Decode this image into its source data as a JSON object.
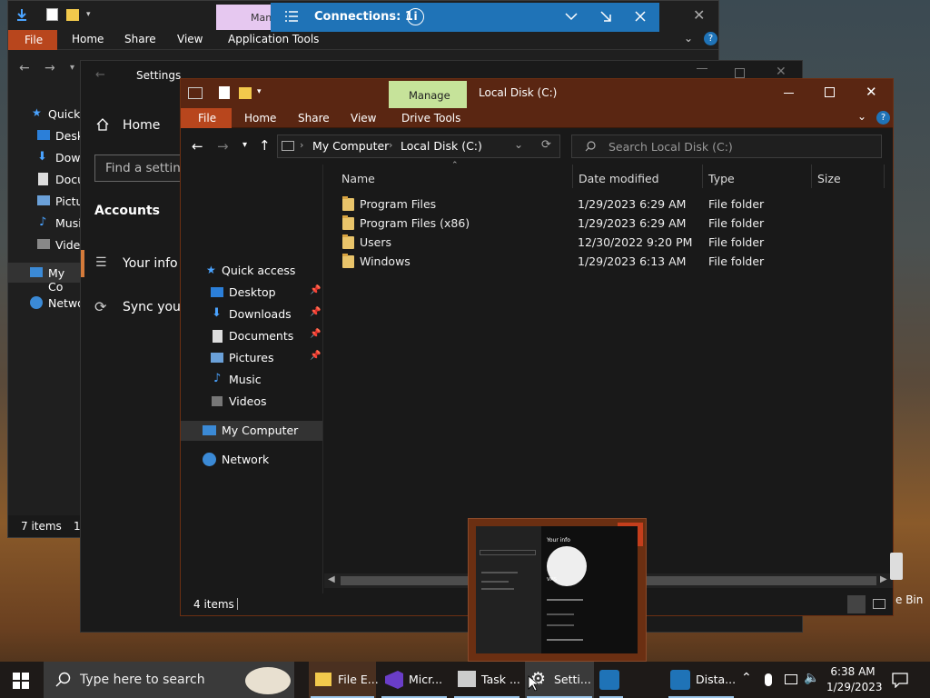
{
  "back_explorer": {
    "contextual_tab": "Manage",
    "tabs": [
      "File",
      "Home",
      "Share",
      "View",
      "Application Tools"
    ],
    "nav_items": [
      "Quick",
      "Deskt",
      "Down",
      "Docu",
      "Pictu",
      "Musi",
      "Video",
      "My Co",
      "Netwo"
    ],
    "status": "7 items",
    "status_suffix": "1"
  },
  "connection_bar": {
    "title": "Connections: 1"
  },
  "settings": {
    "title": "Settings",
    "home": "Home",
    "search_placeholder": "Find a setting",
    "section": "Accounts",
    "items": [
      "Your info",
      "Sync your"
    ]
  },
  "explorer": {
    "contextual_tab": "Manage",
    "title": "Local Disk (C:)",
    "tabs": [
      "File",
      "Home",
      "Share",
      "View",
      "Drive Tools"
    ],
    "breadcrumb": [
      "My Computer",
      "Local Disk (C:)"
    ],
    "search_placeholder": "Search Local Disk (C:)",
    "nav": [
      {
        "label": "Quick access",
        "icon": "star-icon"
      },
      {
        "label": "Desktop",
        "icon": "desktop-icon",
        "pinned": true
      },
      {
        "label": "Downloads",
        "icon": "download-icon",
        "pinned": true
      },
      {
        "label": "Documents",
        "icon": "document-icon",
        "pinned": true
      },
      {
        "label": "Pictures",
        "icon": "pictures-icon",
        "pinned": true
      },
      {
        "label": "Music",
        "icon": "music-icon"
      },
      {
        "label": "Videos",
        "icon": "video-icon"
      },
      {
        "label": "My Computer",
        "icon": "computer-icon",
        "selected": true
      },
      {
        "label": "Network",
        "icon": "network-icon"
      }
    ],
    "columns": [
      "Name",
      "Date modified",
      "Type",
      "Size"
    ],
    "rows": [
      {
        "name": "Program Files",
        "date": "1/29/2023 6:29 AM",
        "type": "File folder",
        "size": ""
      },
      {
        "name": "Program Files (x86)",
        "date": "1/29/2023 6:29 AM",
        "type": "File folder",
        "size": ""
      },
      {
        "name": "Users",
        "date": "12/30/2022 9:20 PM",
        "type": "File folder",
        "size": ""
      },
      {
        "name": "Windows",
        "date": "1/29/2023 6:13 AM",
        "type": "File folder",
        "size": ""
      }
    ],
    "status": "4 items"
  },
  "thumbnail": {
    "title": "Your info",
    "user": "VMS"
  },
  "desktop": {
    "recycle_label": "e Bin"
  },
  "taskbar": {
    "search_placeholder": "Type here to search",
    "apps": [
      "File E...",
      "Micr...",
      "Task ...",
      "Setti...",
      "",
      "Dista..."
    ],
    "time": "6:38 AM",
    "date": "1/29/2023"
  },
  "colors": {
    "accent_title": "#5a2612",
    "manage_tab": "#c6e39a",
    "connection_bar": "#1f73b7",
    "taskbar": "#1e1a18"
  }
}
